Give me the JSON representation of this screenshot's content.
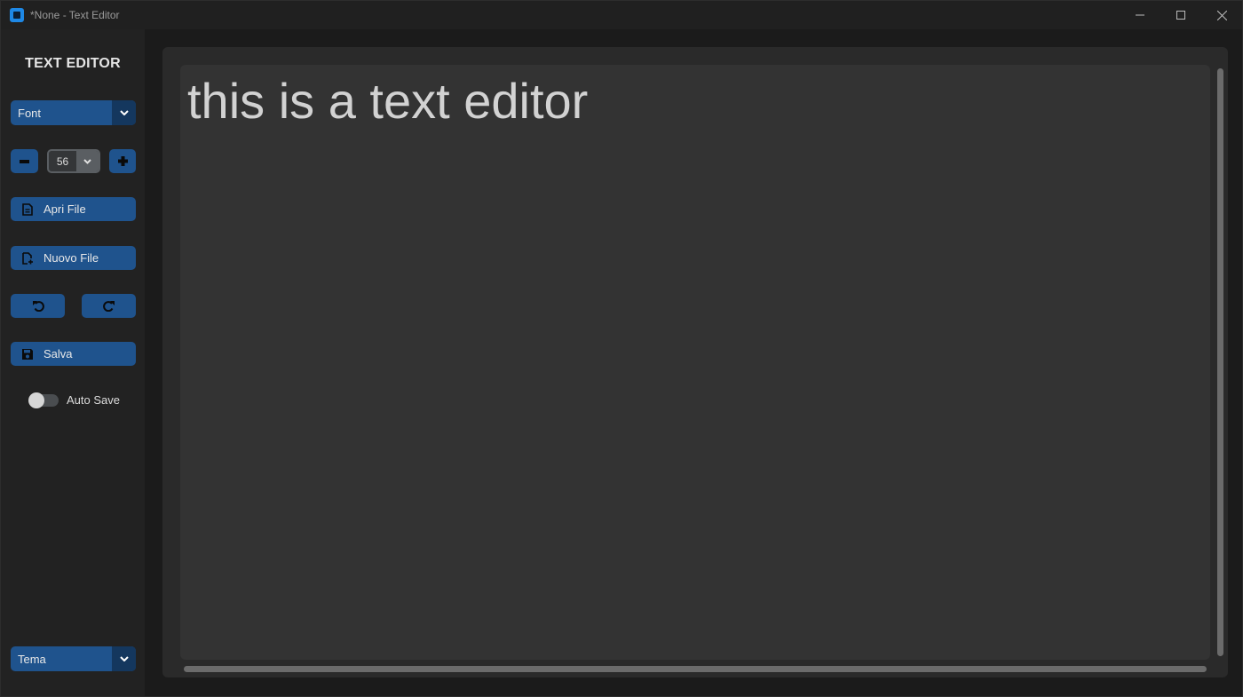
{
  "window": {
    "title": "*None - Text Editor",
    "controls": [
      "minimize-icon",
      "maximize-icon",
      "close-icon"
    ]
  },
  "sidebar": {
    "title": "TEXT EDITOR",
    "font_combo": {
      "value": "Font"
    },
    "font_size": {
      "value": "56",
      "decrease_icon": "minus-icon",
      "increase_icon": "plus-icon"
    },
    "open_file": {
      "label": "Apri File",
      "icon": "document-icon"
    },
    "new_file": {
      "label": "Nuovo File",
      "icon": "new-document-icon"
    },
    "undo_icon": "undo-icon",
    "redo_icon": "redo-icon",
    "save": {
      "label": "Salva",
      "icon": "save-icon"
    },
    "auto_save": {
      "label": "Auto Save",
      "on": false
    },
    "theme_combo": {
      "value": "Tema"
    }
  },
  "editor": {
    "content": "this is a text editor"
  },
  "colors": {
    "accent": "#1f538d",
    "accent_dark": "#14375e",
    "background": "#1b1b1b",
    "sidebar": "#222222",
    "editor": "#333333"
  }
}
